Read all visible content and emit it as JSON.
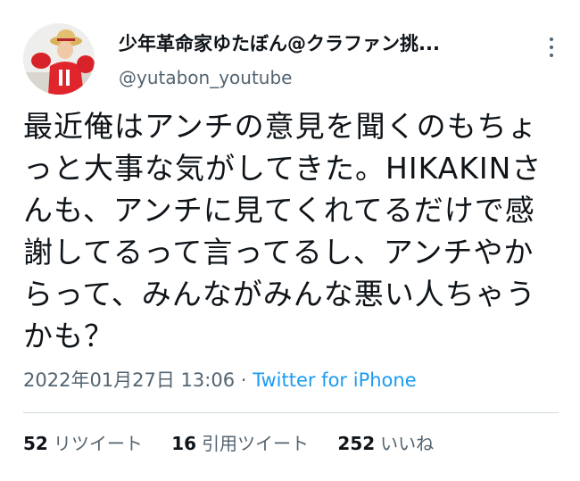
{
  "user": {
    "display_name": "少年革命家ゆたぼん@クラファン挑...",
    "handle": "@yutabon_youtube"
  },
  "tweet": {
    "text": "最近俺はアンチの意見を聞くのもちょっと大事な気がしてきた。HIKAKINさんも、アンチに見てくれてるだけで感謝してるって言ってるし、アンチやからって、みんながみんな悪い人ちゃうかも？",
    "timestamp": "2022年01月27日 13:06",
    "separator": " · ",
    "source": "Twitter for iPhone"
  },
  "stats": {
    "retweets": {
      "count": "52",
      "label": "リツイート"
    },
    "quotes": {
      "count": "16",
      "label": "引用ツイート"
    },
    "likes": {
      "count": "252",
      "label": "いいね"
    }
  },
  "colors": {
    "text": "#0f1419",
    "secondary": "#536471",
    "link": "#1d9bf0",
    "divider": "#cfd9de"
  },
  "icons": {
    "more": "more-vertical-icon"
  }
}
